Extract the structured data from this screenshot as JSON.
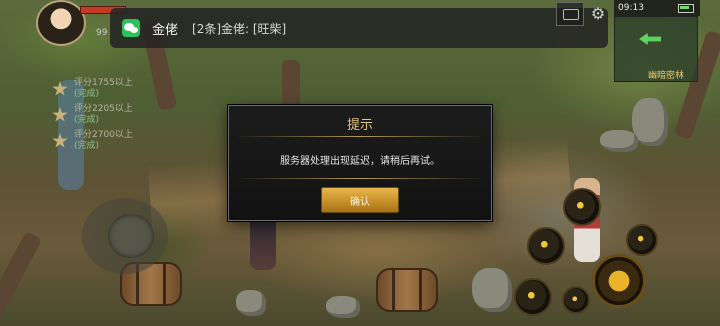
{
  "notification": {
    "sender": "金佬",
    "message": "[2条]金佬: [旺柴]",
    "app_icon": "wechat-icon"
  },
  "hud": {
    "player_level": "99",
    "time": "09:13",
    "map_name": "幽暗密林"
  },
  "quests": [
    {
      "label": "评分1755以上",
      "status": "(完成)"
    },
    {
      "label": "评分2205以上",
      "status": "(完成)"
    },
    {
      "label": "评分2700以上",
      "status": "(完成)"
    }
  ],
  "dialog": {
    "title": "提示",
    "message": "服务器处理出现延迟，请稍后再试。",
    "confirm_label": "确认"
  },
  "colors": {
    "accent_gold": "#e3c889",
    "button_gold": "#c8902a",
    "wechat_green": "#2ec15a"
  }
}
